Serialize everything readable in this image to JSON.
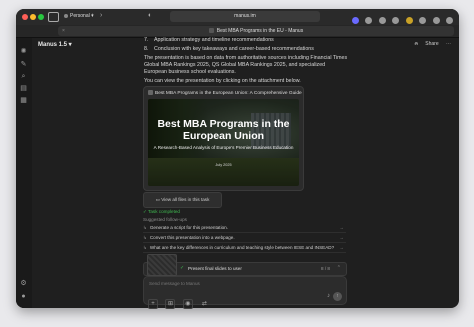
{
  "browser": {
    "profile_label": "Personal",
    "address": "manus.im",
    "tab_title": "Best MBA Programs in the EU - Manus"
  },
  "app": {
    "title": "Manus 1.5",
    "header_actions": [
      "Share"
    ]
  },
  "message": {
    "items": [
      {
        "num": "7.",
        "text": "Application strategy and timeline recommendations"
      },
      {
        "num": "8.",
        "text": "Conclusion with key takeaways and career-based recommendations"
      }
    ],
    "paragraph1": "The presentation is based on data from authoritative sources including Financial Times Global MBA Rankings 2025, QS Global MBA Rankings 2025, and specialized European business school evaluations.",
    "paragraph2": "You can view the presentation by clicking on the attachment below."
  },
  "attachment": {
    "title": "Best MBA Programs in the European Union: A Comprehensive Guide",
    "slide_title": "Best MBA Programs in the European Union",
    "slide_subtitle": "A Research-Based Analysis of Europe's Premier Business Education",
    "slide_date": "July 2025"
  },
  "view_all_label": "View all files in this task",
  "status_text": "Task completed",
  "suggestions_label": "Suggested follow-ups",
  "suggestions": [
    "Generate a script for this presentation.",
    "Convert this presentation into a webpage.",
    "What are the key differences in curriculum and teaching style between IESE and INSEAD?"
  ],
  "progress": {
    "text": "Present final slides to user",
    "count": "8 / 8"
  },
  "composer": {
    "placeholder": "Send message to Manus"
  },
  "colors": {
    "accent_green": "#3fb950",
    "background": "#1f1f1f"
  }
}
